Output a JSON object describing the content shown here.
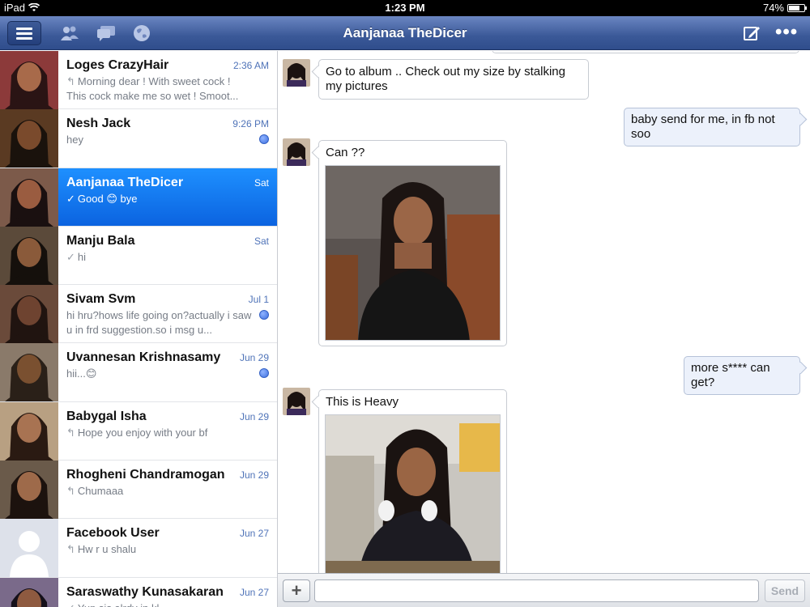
{
  "status": {
    "device": "iPad",
    "time": "1:23 PM",
    "battery": "74%",
    "battery_level": 0.74
  },
  "nav": {
    "title": "Aanjanaa TheDicer"
  },
  "conversations": [
    {
      "name": "Loges CrazyHair",
      "time": "2:36 AM",
      "preview": "Morning dear ! With sweet cock ! This cock make me so wet ! Smoot...",
      "glyph": "↰",
      "unread": false,
      "selected": false
    },
    {
      "name": "Nesh Jack",
      "time": "9:26 PM",
      "preview": "hey",
      "glyph": "",
      "unread": true,
      "selected": false
    },
    {
      "name": "Aanjanaa TheDicer",
      "time": "Sat",
      "preview": "Good 😊 bye",
      "glyph": "✓",
      "unread": false,
      "selected": true
    },
    {
      "name": "Manju Bala",
      "time": "Sat",
      "preview": "hi",
      "glyph": "✓",
      "unread": false,
      "selected": false
    },
    {
      "name": "Sivam Svm",
      "time": "Jul 1",
      "preview": "hi hru?hows life going on?actually i saw u in frd suggestion.so i msg u...",
      "glyph": "",
      "unread": true,
      "selected": false
    },
    {
      "name": "Uvannesan Krishnasamy",
      "time": "Jun 29",
      "preview": "hii...😊",
      "glyph": "",
      "unread": true,
      "selected": false
    },
    {
      "name": "Babygal Isha",
      "time": "Jun 29",
      "preview": "Hope you enjoy with your bf",
      "glyph": "↰",
      "unread": false,
      "selected": false
    },
    {
      "name": "Rhogheni Chandramogan",
      "time": "Jun 29",
      "preview": "Chumaaa",
      "glyph": "↰",
      "unread": false,
      "selected": false
    },
    {
      "name": "Facebook User",
      "time": "Jun 27",
      "preview": "Hw r u shalu",
      "glyph": "↰",
      "unread": false,
      "selected": false
    },
    {
      "name": "Saraswathy Kunasakaran",
      "time": "Jun 27",
      "preview": "Yup sis alrdy in kl",
      "glyph": "✓",
      "unread": false,
      "selected": false
    }
  ],
  "messages": [
    {
      "direction": "in",
      "text": "Go to album .. Check out my size by stalking my pictures"
    },
    {
      "direction": "out",
      "text": "baby send for me, in fb not soo"
    },
    {
      "direction": "in",
      "text": "Can ??",
      "has_photo": true
    },
    {
      "direction": "out",
      "text": "more s**** can get?"
    },
    {
      "direction": "in",
      "text": "This is Heavy",
      "has_photo": true
    }
  ],
  "composer": {
    "placeholder": "",
    "send_label": "Send",
    "add_label": "+"
  },
  "colors": {
    "nav_blue": "#3b5998",
    "selected_blue": "#1e78f0",
    "link_blue": "#4f73b8"
  }
}
